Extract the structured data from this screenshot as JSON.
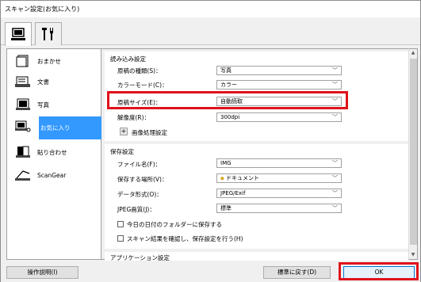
{
  "window": {
    "title": "スキャン設定(お気に入り)"
  },
  "tabs": [
    {
      "name": "scan-from-computer",
      "icon": "computer-scan-icon"
    },
    {
      "name": "general-settings",
      "icon": "tools-icon"
    }
  ],
  "sidebar": {
    "items": [
      {
        "label": "おまかせ",
        "icon": "auto-icon"
      },
      {
        "label": "文書",
        "icon": "document-icon"
      },
      {
        "label": "写真",
        "icon": "photo-icon"
      },
      {
        "label": "お気に入り",
        "icon": "favorite-icon"
      },
      {
        "label": "貼り合わせ",
        "icon": "stitch-icon"
      },
      {
        "label": "ScanGear",
        "icon": "scangear-icon"
      }
    ]
  },
  "scan_options": {
    "title": "読み込み設定",
    "source_label": "原稿の種類(S)：",
    "source_value": "写真",
    "color_label": "カラーモード(C)：",
    "color_value": "カラー",
    "size_label": "原稿サイズ(E)：",
    "size_value": "自動読取",
    "resolution_label": "解像度(R)：",
    "resolution_value": "300dpi",
    "image_processing_label": "画像処理設定",
    "plus": "+"
  },
  "save_settings": {
    "title": "保存設定",
    "filename_label": "ファイル名(F)：",
    "filename_value": "IMG",
    "save_in_label": "保存する場所(V)：",
    "save_in_value": "ドキュメント",
    "format_label": "データ形式(O)：",
    "format_value": "JPEG/Exif",
    "quality_label": "JPEG画質(J)：",
    "quality_value": "標準",
    "subfolder_label": "今日の日付のフォルダーに保存する",
    "confirm_label": "スキャン結果を確認し、保存設定を行う(H)"
  },
  "app_settings": {
    "title": "アプリケーション設定"
  },
  "buttons": {
    "instructions": "操作説明(I)",
    "defaults": "標準に戻す(D)",
    "ok": "OK"
  },
  "colors": {
    "highlight": "#e0121b",
    "selection": "#3399ff"
  }
}
